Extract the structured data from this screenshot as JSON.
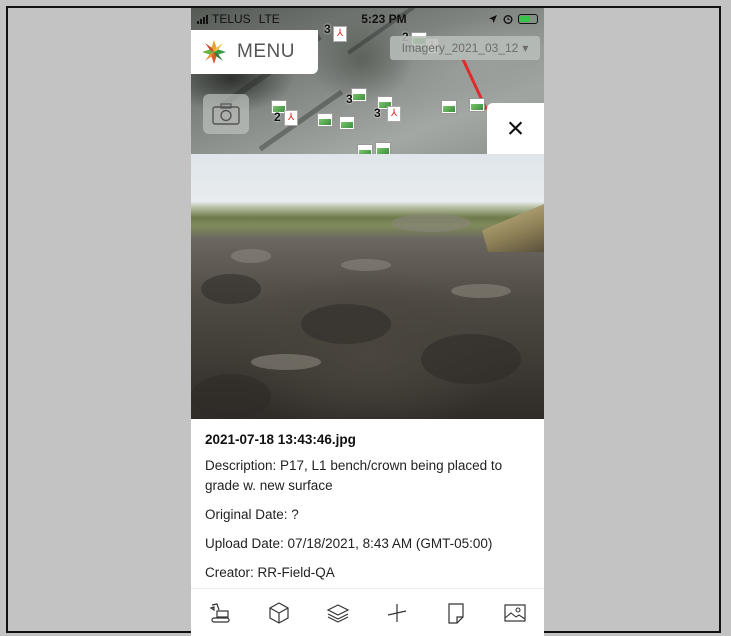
{
  "status_bar": {
    "carrier": "TELUS",
    "network": "LTE",
    "time": "5:23 PM"
  },
  "map": {
    "menu_label": "MENU",
    "imagery_selector": "Imagery_2021_03_12",
    "imagery_caret": "▾",
    "marker_counts": [
      "3",
      "2",
      "3",
      "3",
      "2"
    ]
  },
  "close_button": {
    "label": "×"
  },
  "photo_info": {
    "filename": "2021-07-18 13:43:46.jpg",
    "description": "Description: P17, L1 bench/crown being placed to grade w. new surface",
    "original_date": "Original Date: ?",
    "upload_date": "Upload Date: 07/18/2021, 8:43 AM (GMT-05:00)",
    "creator": "Creator: RR-Field-QA"
  },
  "toolbar": {
    "items": [
      {
        "icon": "excavator-icon"
      },
      {
        "icon": "cube-icon"
      },
      {
        "icon": "layers-icon"
      },
      {
        "icon": "measure-icon"
      },
      {
        "icon": "note-icon"
      },
      {
        "icon": "image-icon"
      }
    ]
  },
  "colors": {
    "background": "#c3c3c3",
    "battery_charging": "#38c24a",
    "line_red": "#e02b2b"
  }
}
